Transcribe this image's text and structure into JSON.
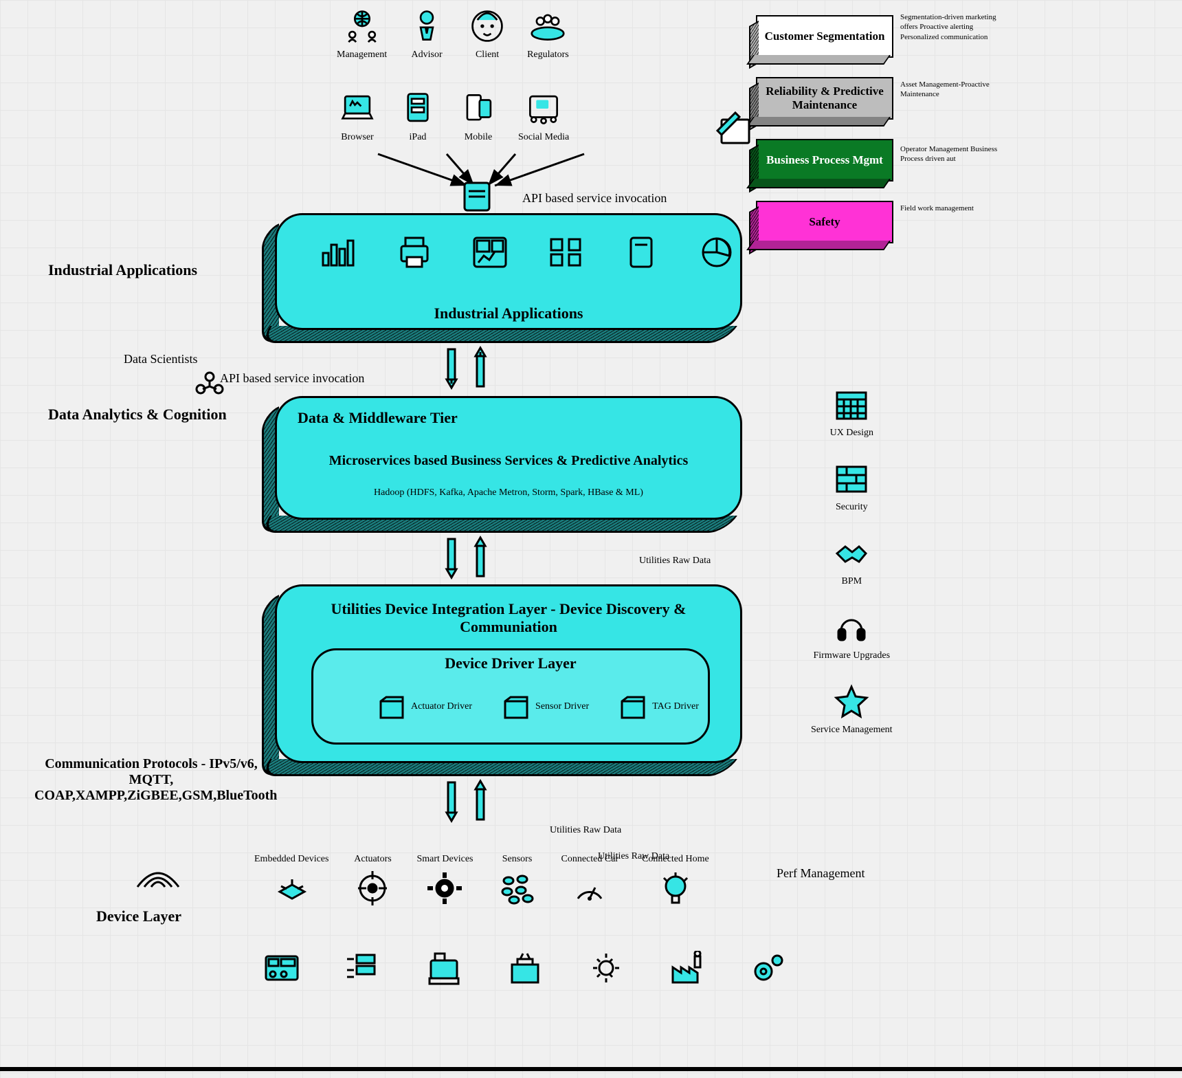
{
  "topActors": {
    "management": "Management",
    "advisor": "Advisor",
    "client": "Client",
    "regulators": "Regulators"
  },
  "devices": {
    "browser": "Browser",
    "ipad": "iPad",
    "mobile": "Mobile",
    "social": "Social Media"
  },
  "apiLabel1": "API based service invocation",
  "apiLabel2": "API based service invocation",
  "leftLabels": {
    "industrialApps": "Industrial Applications",
    "dataScientists": "Data Scientists",
    "analytics": "Data Analytics & Cognition",
    "protocols": "Communication Protocols - IPv5/v6, MQTT, COAP,XAMPP,ZiGBEE,GSM,BlueTooth",
    "deviceLayer": "Device Layer"
  },
  "tiers": {
    "t1": "Industrial Applications",
    "t2title": "Data & Middleware Tier",
    "t2main": "Microservices based Business Services & Predictive Analytics",
    "t2sub": "Hadoop (HDFS, Kafka, Apache Metron, Storm, Spark, HBase & ML)",
    "t3title": "Utilities Device Integration Layer - Device Discovery & Communiation",
    "t3sub": "Device Driver Layer",
    "drivers": {
      "actuator": "Actuator Driver",
      "sensor": "Sensor Driver",
      "tag": "TAG Driver"
    }
  },
  "utilRaw1": "Utilities Raw Data",
  "utilRaw2": "Utilities Raw Data",
  "utilRaw3": "Utilities Raw Data",
  "bizCards": [
    {
      "label": "Customer Segmentation",
      "note": "Segmentation-driven marketing offers\nProactive alerting\nPersonalized communication",
      "bg": "#fff",
      "color": "#000"
    },
    {
      "label": "Reliability & Predictive Maintenance",
      "note": "Asset Management-Proactive Maintenance",
      "bg": "#bdbdbd",
      "color": "#000"
    },
    {
      "label": "Business Process Mgmt",
      "note": "Operator Management\nBusiness Process driven aut",
      "bg": "#0a7a25",
      "color": "#fff"
    },
    {
      "label": "Safety",
      "note": "Field work management",
      "bg": "#ff32d6",
      "color": "#000"
    }
  ],
  "rightRail": [
    "UX Design",
    "Security",
    "BPM",
    "Firmware Upgrades",
    "Service Management"
  ],
  "bottomDevices": [
    "Embedded Devices",
    "Actuators",
    "Smart Devices",
    "Sensors",
    "Connected Car",
    "Connected Home"
  ],
  "perf": "Perf Management"
}
